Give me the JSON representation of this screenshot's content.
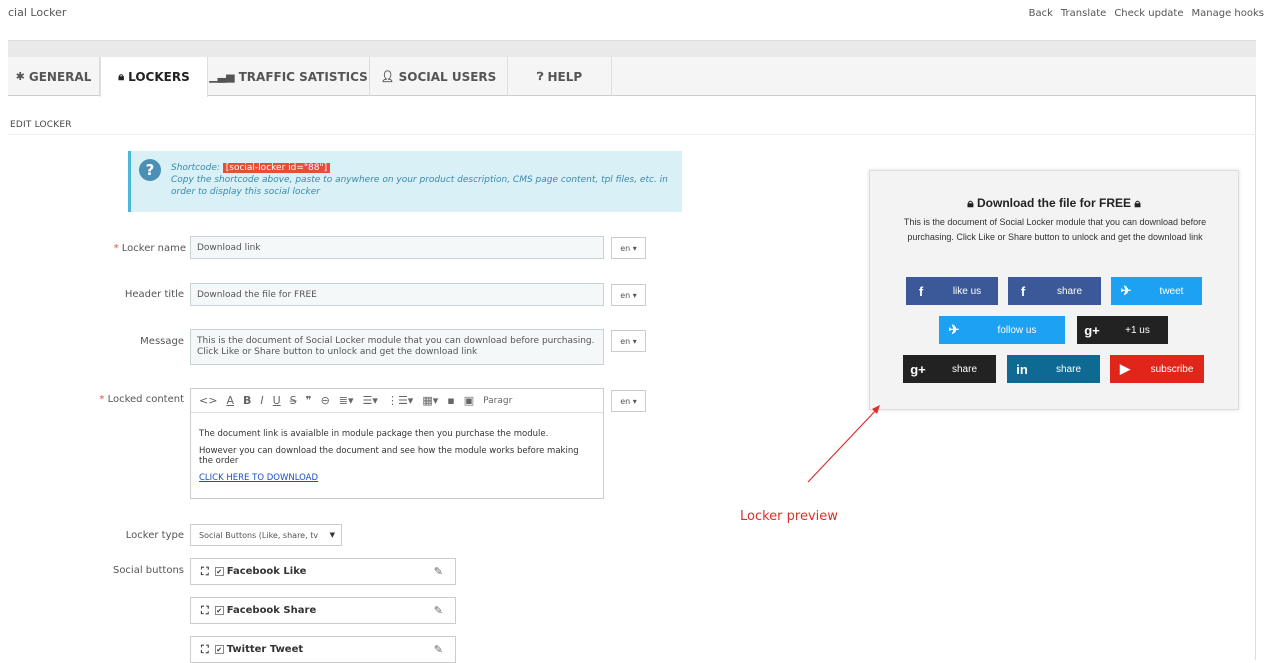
{
  "app": {
    "title": "cial Locker"
  },
  "top_links": [
    "Back",
    "Translate",
    "Check update",
    "Manage hooks"
  ],
  "tabs": [
    {
      "label": "GENERAL",
      "icon": "gear-icon",
      "active": false
    },
    {
      "label": "LOCKERS",
      "icon": "lock-icon",
      "active": true
    },
    {
      "label": "TRAFFIC SATISTICS",
      "icon": "bar-chart-icon",
      "active": false
    },
    {
      "label": "SOCIAL USERS",
      "icon": "user-icon",
      "active": false
    },
    {
      "label": "HELP",
      "icon": "question-circle-icon",
      "active": false
    }
  ],
  "section_title": "EDIT LOCKER",
  "info": {
    "shortcode_label": "Shortcode:",
    "shortcode": "[social-locker id=\"88\"]",
    "text": "Copy the shortcode above, paste to anywhere on your product description, CMS page content, tpl files, etc. in order to display this social locker"
  },
  "form": {
    "locker_name": {
      "label": "Locker name",
      "required": "*",
      "value": "Download link",
      "lang": "en"
    },
    "header_title": {
      "label": "Header title",
      "value": "Download the file for FREE",
      "lang": "en"
    },
    "message": {
      "label": "Message",
      "value": "This is the document of Social Locker module that you can download before purchasing. Click Like or Share button to unlock and get the download link",
      "lang": "en"
    },
    "locked_content": {
      "label": "Locked content",
      "required": "*",
      "lang": "en",
      "paragraph_label": "Paragr",
      "lines": [
        "The document link is avaialble in module package then you purchase the module.",
        "However you can download the document and see how the module works before making the order"
      ],
      "link": "CLICK HERE TO DOWNLOAD"
    },
    "locker_type": {
      "label": "Locker type",
      "value": "Social Buttons (Like, share, tv"
    },
    "social_buttons": {
      "label": "Social buttons",
      "items": [
        "Facebook Like",
        "Facebook Share",
        "Twitter Tweet"
      ]
    }
  },
  "preview": {
    "title": "Download the file for FREE",
    "message": "This is the document of Social Locker module that you can download before purchasing. Click Like or Share button to unlock and get the download link",
    "buttons": [
      {
        "icon": "f",
        "label": "like us",
        "color": "#3b5998"
      },
      {
        "icon": "f",
        "label": "share",
        "color": "#3b5998"
      },
      {
        "icon": "🐦",
        "label": "tweet",
        "color": "#1da1f2"
      },
      {
        "icon": "🐦",
        "label": "follow us",
        "color": "#1da1f2"
      },
      {
        "icon": "g+",
        "label": "+1 us",
        "color": "#222222"
      },
      {
        "icon": "g+",
        "label": "share",
        "color": "#222222"
      },
      {
        "icon": "in",
        "label": "share",
        "color": "#0e6a93"
      },
      {
        "icon": "▶",
        "label": "subscribe",
        "color": "#e0261b"
      }
    ]
  },
  "annotation": "Locker preview",
  "colors": {
    "accent_red": "#e74c3c",
    "info_bg": "#d9f0f7",
    "annotation": "#d9302c"
  }
}
